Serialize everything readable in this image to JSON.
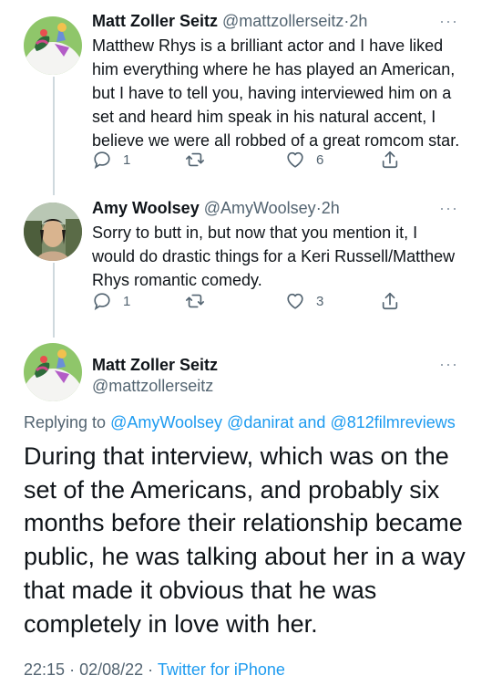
{
  "tweets": [
    {
      "name": "Matt Zoller Seitz",
      "handle": "@mattzollerseitz",
      "separator": "·",
      "time": "2h",
      "lines": [
        "Matthew Rhys is a brilliant actor and I have liked",
        "him everything where he has played an American,",
        "but I have to tell you, having interviewed him on a",
        "set and heard him speak in his natural  accent, I",
        "believe we were all robbed of a great romcom star."
      ],
      "reply_count": "1",
      "retweet_count": "",
      "like_count": "6"
    },
    {
      "name": "Amy Woolsey",
      "handle": "@AmyWoolsey",
      "separator": "·",
      "time": "2h",
      "lines": [
        "Sorry to butt in, but now that you mention it, I",
        "would do drastic things for a Keri Russell/Matthew",
        "Rhys romantic comedy."
      ],
      "reply_count": "1",
      "retweet_count": "",
      "like_count": "3"
    }
  ],
  "main_tweet": {
    "name": "Matt Zoller Seitz",
    "handle": "@mattzollerseitz",
    "replying_prefix": "Replying to",
    "mention_1": "@AmyWoolsey",
    "mention_2": "@danirat",
    "and_word": "and",
    "mention_3": "@812filmreviews",
    "lines": [
      "During that interview, which was on the",
      "set of the Americans, and probably six",
      "months before their relationship became",
      "public, he was talking about her in a way",
      "that made it obvious that he was",
      "completely in love with her."
    ],
    "time": "22:15",
    "date": "02/08/22",
    "separator": "·",
    "source": "Twitter for iPhone"
  },
  "more_glyph": "···",
  "colors": {
    "accent": "#1d9bf0",
    "text": "#0f1419",
    "secondary": "#536471",
    "thread_line": "#cfd9de"
  },
  "icons": {
    "reply": "reply-icon",
    "retweet": "retweet-icon",
    "like": "heart-icon",
    "share": "share-icon",
    "more": "more-icon"
  }
}
